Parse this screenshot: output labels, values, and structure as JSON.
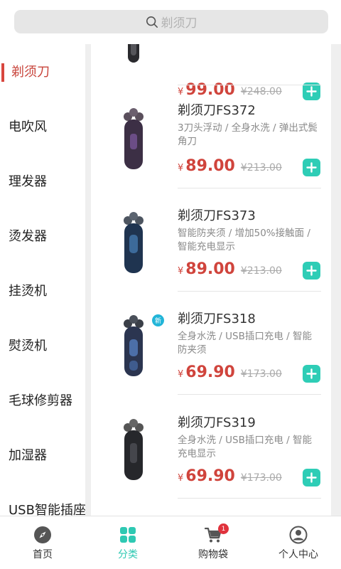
{
  "search": {
    "placeholder": "剃须刀"
  },
  "categories": [
    {
      "label": "剃须刀",
      "active": true
    },
    {
      "label": "电吹风",
      "active": false
    },
    {
      "label": "理发器",
      "active": false
    },
    {
      "label": "烫发器",
      "active": false
    },
    {
      "label": "挂烫机",
      "active": false
    },
    {
      "label": "熨烫机",
      "active": false
    },
    {
      "label": "毛球修剪器",
      "active": false
    },
    {
      "label": "加湿器",
      "active": false
    },
    {
      "label": "USB智能插座",
      "active": false
    }
  ],
  "currency_symbol": "¥",
  "products": [
    {
      "name": "",
      "desc": "",
      "price": "99.00",
      "old_price": "¥248.00",
      "is_new": false,
      "color": "dark"
    },
    {
      "name": "剃须刀FS372",
      "desc": "3刀头浮动 / 全身水洗 / 弹出式鬓角刀",
      "price": "89.00",
      "old_price": "¥213.00",
      "is_new": false,
      "color": "purple"
    },
    {
      "name": "剃须刀FS373",
      "desc": "智能防夹须 / 增加50%接触面 / 智能充电显示",
      "price": "89.00",
      "old_price": "¥213.00",
      "is_new": false,
      "color": "blue"
    },
    {
      "name": "剃须刀FS318",
      "desc": "全身水洗 / USB插口充电 / 智能防夹须",
      "price": "69.90",
      "old_price": "¥173.00",
      "is_new": true,
      "badge": "新",
      "color": "navy"
    },
    {
      "name": "剃须刀FS319",
      "desc": "全身水洗 / USB插口充电 / 智能充电显示",
      "price": "69.90",
      "old_price": "¥173.00",
      "is_new": false,
      "color": "black"
    }
  ],
  "tabs": [
    {
      "label": "首页",
      "icon": "compass-icon",
      "active": false
    },
    {
      "label": "分类",
      "icon": "grid-icon",
      "active": true
    },
    {
      "label": "购物袋",
      "icon": "cart-icon",
      "active": false,
      "badge": "1"
    },
    {
      "label": "个人中心",
      "icon": "user-icon",
      "active": false
    }
  ],
  "colors": {
    "accent": "#2ecdb6",
    "price": "#d0443c",
    "active_category": "#c8443b",
    "badge": "#e0323c"
  }
}
